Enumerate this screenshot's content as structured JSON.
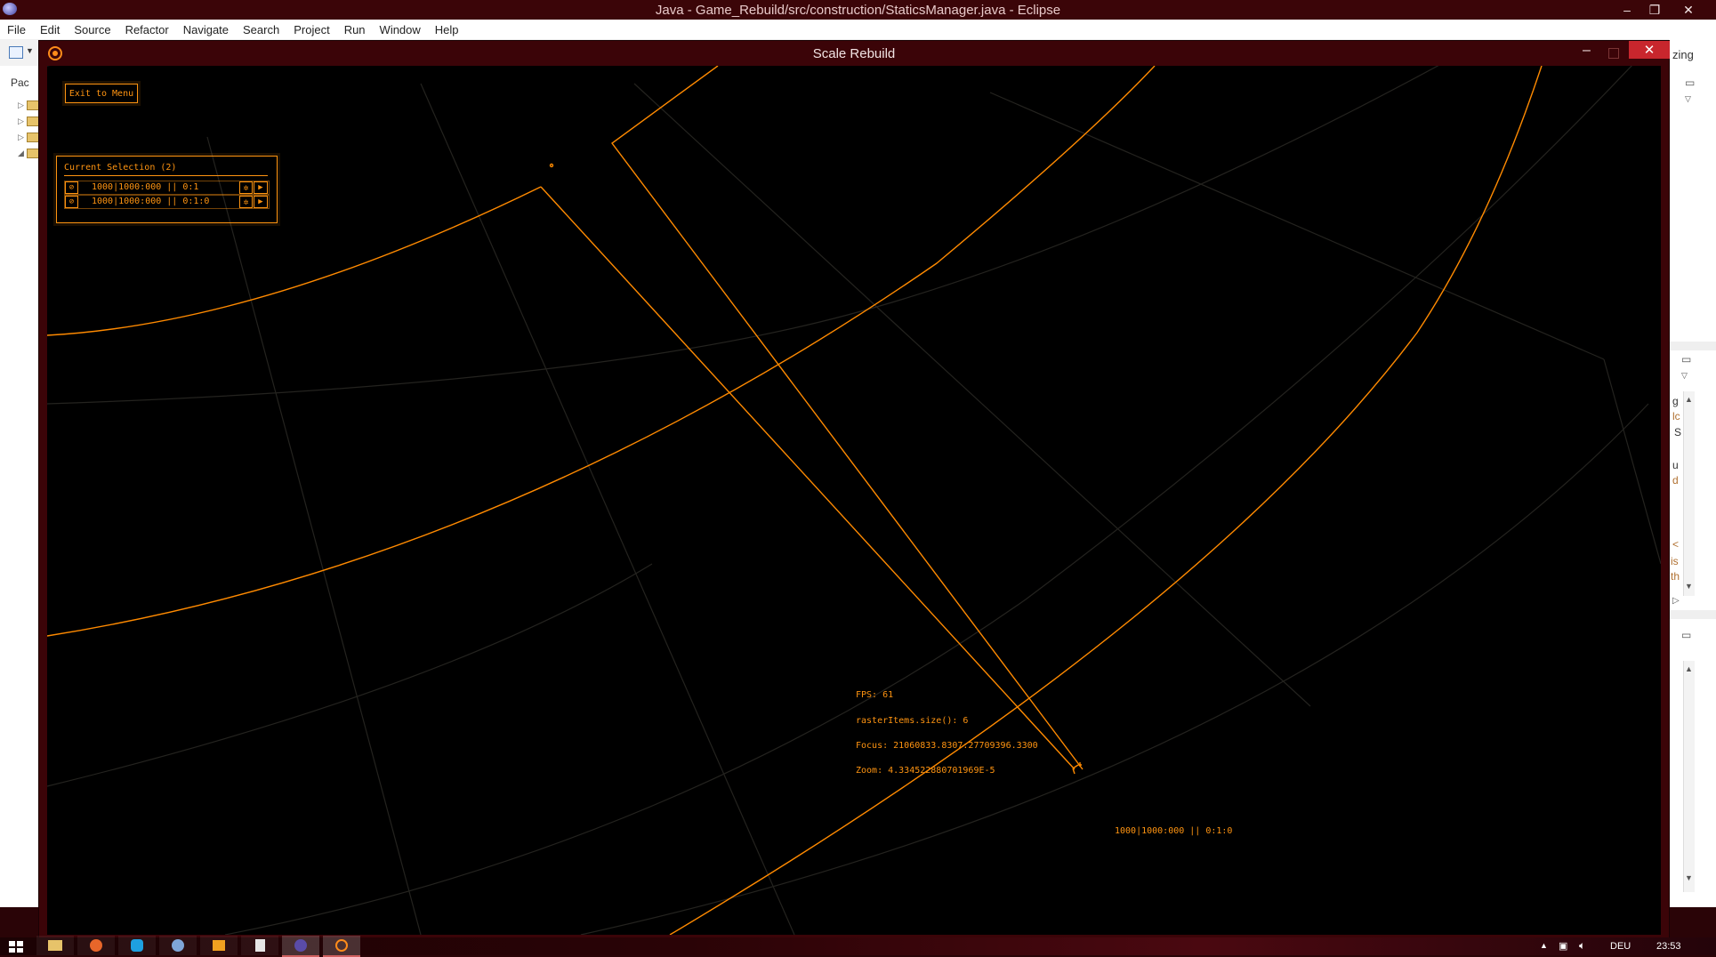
{
  "eclipse": {
    "title": "Java - Game_Rebuild/src/construction/StaticsManager.java - Eclipse",
    "menu": [
      "File",
      "Edit",
      "Source",
      "Refactor",
      "Navigate",
      "Search",
      "Project",
      "Run",
      "Window",
      "Help"
    ],
    "left_pane_tab": "Pac",
    "right_pane_fragment": "zing",
    "right_pane_lines": [
      "g",
      "lc",
      "S",
      "u",
      "d",
      "<",
      "is",
      "th"
    ]
  },
  "game": {
    "title": "Scale Rebuild",
    "exit_label": "Exit to Menu",
    "selection": {
      "title": "Current Selection (2)",
      "rows": [
        {
          "text": "1000|1000:000 || 0:1"
        },
        {
          "text": "1000|1000:000 || 0:1:0"
        }
      ]
    },
    "debug": {
      "fps": "FPS: 61",
      "raster": "rasterItems.size(): 6",
      "focus": "Focus: 21060833.8307:27709396.3300",
      "zoom": "Zoom: 4.334522880701969E-5"
    },
    "cursor_label": "1000|1000:000 || 0:1:0",
    "colors": {
      "accent": "#ff9411",
      "line": "#ff8a00",
      "grid": "#24231f",
      "background": "#000000"
    }
  },
  "taskbar": {
    "language": "DEU",
    "clock": "23:53"
  }
}
